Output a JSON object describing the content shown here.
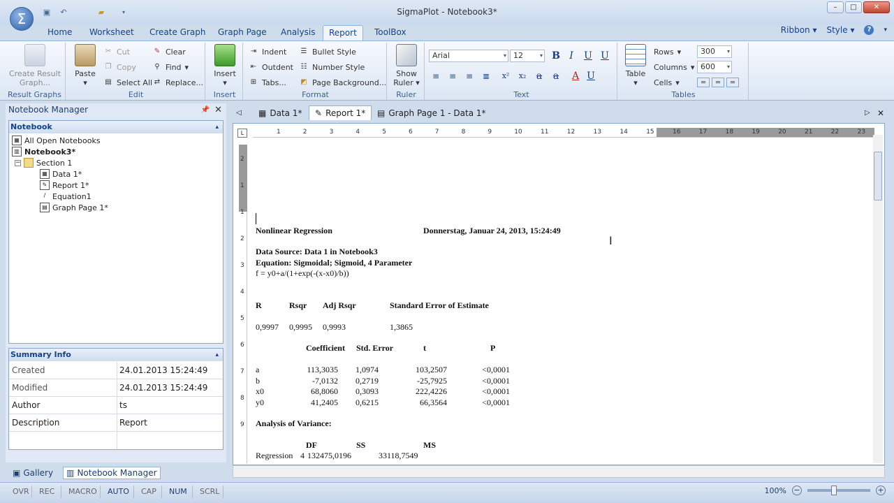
{
  "window": {
    "title": "SigmaPlot - Notebook3*"
  },
  "qat": {
    "icons": [
      "save-icon",
      "undo-icon",
      "open-icon",
      "dropdown-icon"
    ]
  },
  "ribbon_tabs": [
    "Home",
    "Worksheet",
    "Create Graph",
    "Graph Page",
    "Analysis",
    "Report",
    "ToolBox"
  ],
  "active_tab": "Report",
  "ribbon_right": {
    "ribbon_label": "Ribbon",
    "style_label": "Style"
  },
  "groups": {
    "result_graphs": {
      "label": "Result Graphs",
      "button": "Create Result Graph..."
    },
    "edit": {
      "label": "Edit",
      "paste": "Paste",
      "cut": "Cut",
      "copy": "Copy",
      "select_all": "Select All",
      "clear": "Clear",
      "find": "Find",
      "replace": "Replace..."
    },
    "insert": {
      "label": "Insert",
      "insert": "Insert"
    },
    "format": {
      "label": "Format",
      "indent": "Indent",
      "outdent": "Outdent",
      "tabs": "Tabs...",
      "bullet_style": "Bullet Style",
      "number_style": "Number Style",
      "page_background": "Page Background..."
    },
    "ruler": {
      "label": "Ruler",
      "show_ruler": "Show Ruler"
    },
    "text": {
      "label": "Text",
      "font": "Arial",
      "size": "12"
    },
    "tables": {
      "label": "Tables",
      "table": "Table",
      "rows": "Rows",
      "rows_val": "300",
      "columns": "Columns",
      "columns_val": "600",
      "cells": "Cells"
    }
  },
  "notebook_manager": {
    "title": "Notebook Manager",
    "section_label": "Notebook",
    "tree": [
      "All Open Notebooks",
      "Notebook3*",
      "Section 1",
      "Data 1*",
      "Report 1*",
      "Equation1",
      "Graph Page 1*"
    ]
  },
  "summary": {
    "title": "Summary Info",
    "rows": [
      {
        "key": "Created",
        "value": "24.01.2013 15:24:49"
      },
      {
        "key": "Modified",
        "value": "24.01.2013 15:24:49"
      },
      {
        "key": "Author",
        "value": "ts"
      },
      {
        "key": "Description",
        "value": "Report"
      }
    ]
  },
  "bottom_tabs": [
    "Gallery",
    "Notebook Manager"
  ],
  "doc_tabs": [
    "Data 1*",
    "Report 1*",
    "Graph Page 1 - Data 1*"
  ],
  "ruler_numbers": [
    "1",
    "2",
    "3",
    "4",
    "5",
    "6",
    "7",
    "8",
    "9",
    "10",
    "11",
    "12",
    "13",
    "14",
    "15",
    "16",
    "17",
    "18",
    "19",
    "20",
    "21",
    "22",
    "23"
  ],
  "vruler_numbers": [
    "2",
    "1",
    "1",
    "2",
    "3",
    "4",
    "5",
    "6",
    "7",
    "8",
    "9"
  ],
  "report": {
    "title": "Nonlinear Regression",
    "date": "Donnerstag, Januar 24, 2013, 15:24:49",
    "data_source": "Data Source: Data 1 in Notebook3",
    "equation": "Equation: Sigmoidal; Sigmoid, 4 Parameter",
    "formula": "f = y0+a/(1+exp(-(x-x0)/b))",
    "fit_headers": [
      "R",
      "Rsqr",
      "Adj Rsqr",
      "Standard Error of Estimate"
    ],
    "fit_values": [
      "0,9997",
      "0,9995",
      "0,9993",
      "1,3865"
    ],
    "coef_headers": [
      "Coefficient",
      "Std. Error",
      "t",
      "P"
    ],
    "coef_rows": [
      [
        "a",
        "113,3035",
        "1,0974",
        "103,2507",
        "<0,0001"
      ],
      [
        "b",
        "-7,0132",
        "0,2719",
        "-25,7925",
        "<0,0001"
      ],
      [
        "x0",
        "68,8060",
        "0,3093",
        "222,4226",
        "<0,0001"
      ],
      [
        "y0",
        "41,2405",
        "0,6215",
        "66,3564",
        "<0,0001"
      ]
    ],
    "anova_title": "Analysis of Variance:",
    "anova_headers": [
      "DF",
      "SS",
      "MS"
    ],
    "anova_row": [
      "Regression",
      "4",
      "132475,0196",
      "33118,7549"
    ]
  },
  "status": [
    "OVR",
    "REC",
    "MACRO",
    "AUTO",
    "CAP",
    "NUM",
    "SCRL"
  ],
  "status_on": [
    "AUTO",
    "NUM"
  ],
  "zoom": "100%"
}
